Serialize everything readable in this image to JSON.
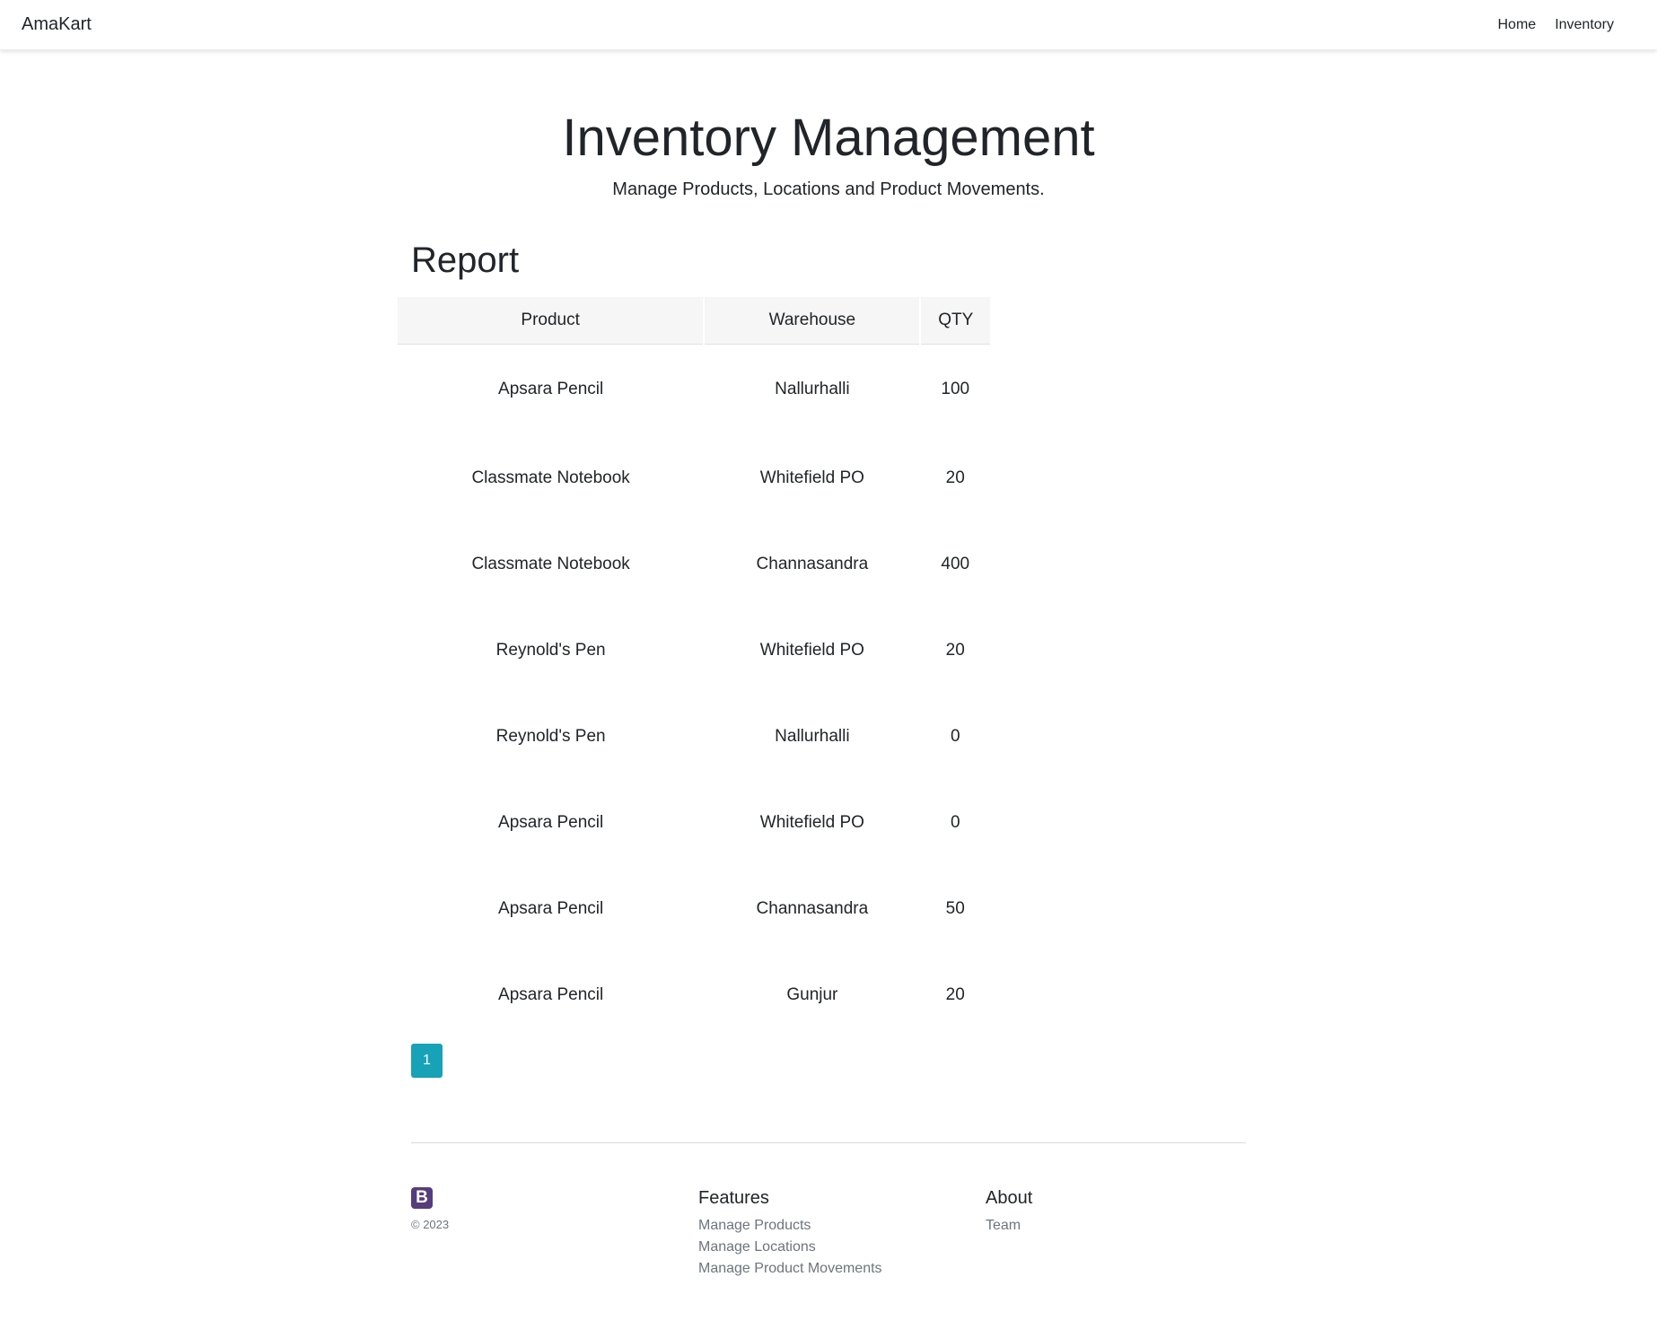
{
  "navbar": {
    "brand": "AmaKart",
    "links": [
      "Home",
      "Inventory"
    ]
  },
  "hero": {
    "title": "Inventory Management",
    "subtitle": "Manage Products, Locations and Product Movements."
  },
  "report": {
    "heading": "Report",
    "columns": [
      "Product",
      "Warehouse",
      "QTY"
    ],
    "rows": [
      [
        "Apsara Pencil",
        "Nallurhalli",
        "100"
      ],
      [
        "Classmate Notebook",
        "Whitefield PO",
        "20"
      ],
      [
        "Classmate Notebook",
        "Channasandra",
        "400"
      ],
      [
        "Reynold's Pen",
        "Whitefield PO",
        "20"
      ],
      [
        "Reynold's Pen",
        "Nallurhalli",
        "0"
      ],
      [
        "Apsara Pencil",
        "Whitefield PO",
        "0"
      ],
      [
        "Apsara Pencil",
        "Channasandra",
        "50"
      ],
      [
        "Apsara Pencil",
        "Gunjur",
        "20"
      ]
    ]
  },
  "pagination": {
    "current_page": "1"
  },
  "footer": {
    "logo_letter": "B",
    "copyright": "© 2023",
    "features": {
      "heading": "Features",
      "links": [
        "Manage Products",
        "Manage Locations",
        "Manage Product Movements"
      ]
    },
    "about": {
      "heading": "About",
      "links": [
        "Team"
      ]
    }
  },
  "colors": {
    "pagination_active": "#17a2b8",
    "logo_bg": "#563d7c",
    "text_primary": "#212529",
    "text_muted": "#6c757d"
  }
}
